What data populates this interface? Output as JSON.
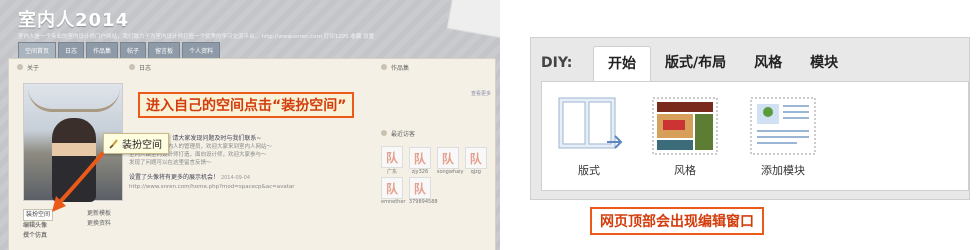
{
  "left": {
    "site_title": "室内人2014",
    "site_sub": "室内人是一个专业的室内设计师门户网站，我们致力于为室内设计师打造一个优秀的学习交流平台... http://www.snren.com  打印1295  收藏  设置",
    "nav": [
      "空间首页",
      "日志",
      "作品集",
      "帖子",
      "留言板",
      "个人资料"
    ],
    "col_about": "关于",
    "col_blog": "日志",
    "col_works": "作品集",
    "col_recent": "最近访客",
    "blog_lines": [
      "9.14全面开放！请大家发现问题及时与我们联系~",
      "大家好，我是室内人的管理员，欢迎大家来到室内人网站～",
      "室内人由室内设计师打造，面向设计师，欢迎大家参与～",
      "发现了问题可以在这里留言反馈～",
      "设置了头像将有更多的展示机会！",
      "2014-09-04",
      "http://www.snren.com/home.php?mod=spacecp&ac=avatar"
    ],
    "visitors": [
      "广东",
      "zjy326",
      "songwhaiy",
      "qjzg",
      "emnether",
      "379894588"
    ],
    "left_links": [
      "装扮空间",
      "编辑头像",
      "撰个仿真"
    ],
    "right_links": [
      "更新模板",
      "更换资料"
    ],
    "works_link": "查看更多"
  },
  "callout_top": "进入自己的空间点击“装扮空间”",
  "tooltip": "装扮空间",
  "diy": {
    "label": "DIY:",
    "tabs": [
      "开始",
      "版式/布局",
      "风格",
      "模块"
    ],
    "items": [
      "版式",
      "风格",
      "添加模块"
    ]
  },
  "caption_bottom": "网页顶部会出现编辑窗口",
  "colors": {
    "accent": "#ec5a1a",
    "callout_text": "#d33d0c"
  }
}
